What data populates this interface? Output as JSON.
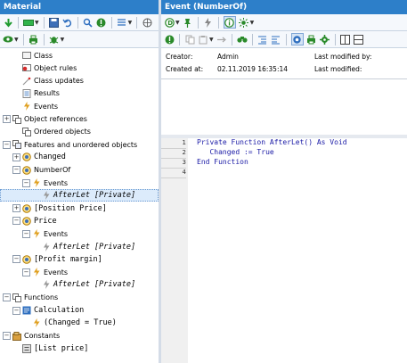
{
  "left_panel": {
    "title": "Material",
    "tree": [
      {
        "label": "Class",
        "indent": 1,
        "icon": "class-icon",
        "expander": "",
        "mono": false
      },
      {
        "label": "Object rules",
        "indent": 1,
        "icon": "object-rules-icon",
        "expander": "",
        "mono": false
      },
      {
        "label": "Class updates",
        "indent": 1,
        "icon": "class-updates-icon",
        "expander": "",
        "mono": false
      },
      {
        "label": "Results",
        "indent": 1,
        "icon": "results-icon",
        "expander": "",
        "mono": false
      },
      {
        "label": "Events",
        "indent": 1,
        "icon": "events-icon",
        "expander": "",
        "mono": false
      },
      {
        "label": "Object references",
        "indent": 0,
        "icon": "object-references-icon",
        "expander": "+",
        "mono": false
      },
      {
        "label": "Ordered objects",
        "indent": 1,
        "icon": "ordered-objects-icon",
        "expander": "",
        "mono": false
      },
      {
        "label": "Features and unordered objects",
        "indent": 0,
        "icon": "features-icon",
        "expander": "-",
        "mono": false
      },
      {
        "label": "Changed",
        "indent": 1,
        "icon": "feature-icon",
        "expander": "+",
        "mono": true
      },
      {
        "label": "NumberOf",
        "indent": 1,
        "icon": "feature-icon",
        "expander": "-",
        "mono": false
      },
      {
        "label": "Events",
        "indent": 2,
        "icon": "events-icon",
        "expander": "-",
        "mono": false
      },
      {
        "label": "AfterLet [Private]",
        "indent": 3,
        "icon": "event-icon",
        "expander": "",
        "mono": true,
        "italic": true,
        "selected": true
      },
      {
        "label": "[Position Price]",
        "indent": 1,
        "icon": "feature-icon",
        "expander": "+",
        "mono": true
      },
      {
        "label": "Price",
        "indent": 1,
        "icon": "feature-icon",
        "expander": "-",
        "mono": true
      },
      {
        "label": "Events",
        "indent": 2,
        "icon": "events-icon",
        "expander": "-",
        "mono": false
      },
      {
        "label": "AfterLet [Private]",
        "indent": 3,
        "icon": "event-icon",
        "expander": "",
        "mono": true,
        "italic": true
      },
      {
        "label": "[Profit margin]",
        "indent": 1,
        "icon": "feature-icon",
        "expander": "-",
        "mono": true
      },
      {
        "label": "Events",
        "indent": 2,
        "icon": "events-icon",
        "expander": "-",
        "mono": false
      },
      {
        "label": "AfterLet [Private]",
        "indent": 3,
        "icon": "event-icon",
        "expander": "",
        "mono": true,
        "italic": true
      },
      {
        "label": "Functions",
        "indent": 0,
        "icon": "functions-icon",
        "expander": "-",
        "mono": false
      },
      {
        "label": "Calculation",
        "indent": 1,
        "icon": "function-icon",
        "expander": "-",
        "mono": true
      },
      {
        "label": "(Changed = True)",
        "indent": 2,
        "icon": "condition-icon",
        "expander": "",
        "mono": true
      },
      {
        "label": "Constants",
        "indent": 0,
        "icon": "constants-icon",
        "expander": "-",
        "mono": false
      },
      {
        "label": "[List price]",
        "indent": 1,
        "icon": "constant-icon",
        "expander": "",
        "mono": true
      }
    ]
  },
  "right_panel": {
    "title": "Event (NumberOf)",
    "info": {
      "creator_label": "Creator:",
      "creator_value": "Admin",
      "created_label": "Created at:",
      "created_value": "02.11.2019 16:35:14",
      "modified_by_label": "Last modified by:",
      "modified_label": "Last modified:"
    },
    "code": {
      "line_numbers": [
        "1",
        "2",
        "3",
        "4"
      ],
      "lines": [
        "Private Function AfterLet() As Void",
        "   Changed := True",
        "End Function",
        ""
      ]
    }
  },
  "colors": {
    "title_bar": "#2d7fc9",
    "selection": "#dcebfb",
    "code_text": "#1a1aa6"
  }
}
